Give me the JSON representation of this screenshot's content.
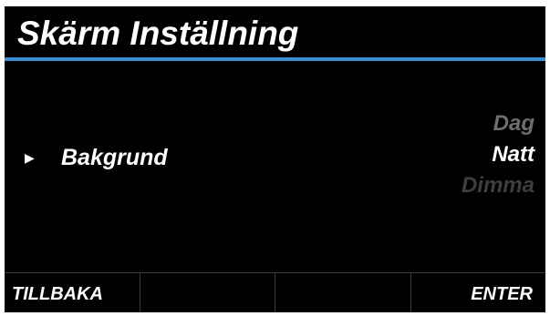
{
  "header": {
    "title": "Skärm Inställning",
    "accent_color": "#3a8fd6"
  },
  "menu": {
    "cursor_icon": "triangle-right",
    "cursor_glyph": "▶",
    "selected_item_label": "Bakgrund"
  },
  "options": [
    {
      "label": "Dag",
      "state": "inactive",
      "color": "#6e6e6e"
    },
    {
      "label": "Natt",
      "state": "selected",
      "color": "#ffffff"
    },
    {
      "label": "Dimma",
      "state": "inactive",
      "color": "#3e3e3e"
    }
  ],
  "softkeys": [
    {
      "label": "TILLBAKA"
    },
    {
      "label": ""
    },
    {
      "label": ""
    },
    {
      "label": "ENTER"
    }
  ]
}
